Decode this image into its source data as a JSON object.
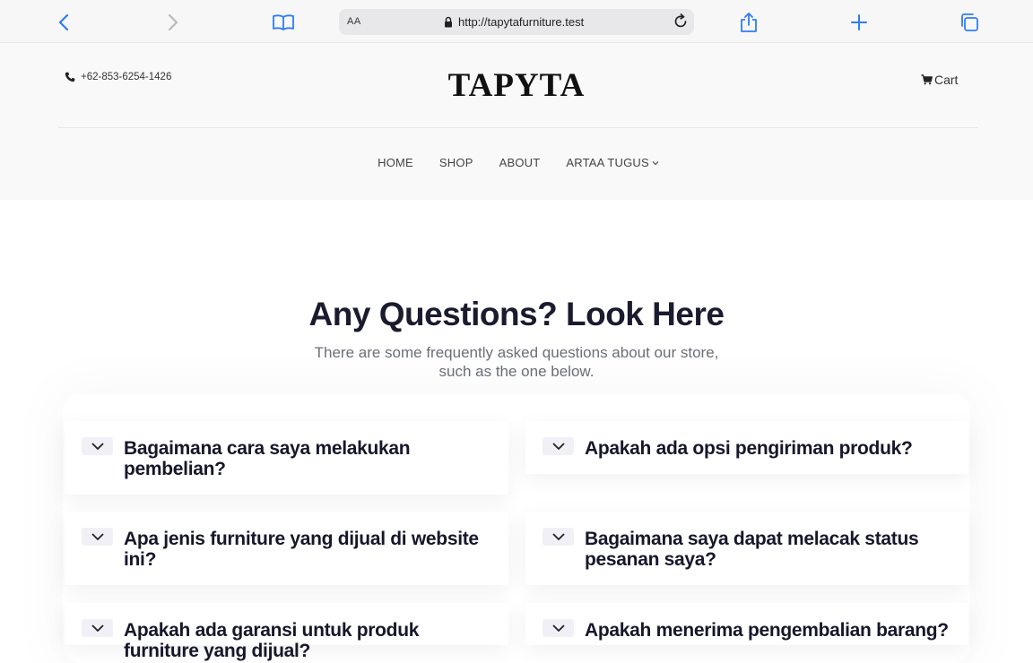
{
  "browser": {
    "url": "http://tapytafurniture.test",
    "reader_label": "AA",
    "icons": [
      "back-icon",
      "forward-icon",
      "bookmarks-icon",
      "lock-icon",
      "reload-icon",
      "share-icon",
      "new-tab-icon",
      "tabs-icon"
    ]
  },
  "header": {
    "phone": "+62-853-6254-1426",
    "logo": "TAPYTA",
    "cart_label": "Cart"
  },
  "nav": {
    "items": [
      "HOME",
      "SHOP",
      "ABOUT",
      "ARTAA TUGUS"
    ]
  },
  "faq": {
    "title": "Any Questions? Look Here",
    "subtitle": "There are some frequently asked questions about our store, such as the one below.",
    "questions": [
      "Bagaimana cara saya melakukan pembelian?",
      "Apakah ada opsi pengiriman produk?",
      "Apa jenis furniture yang dijual di website ini?",
      "Bagaimana saya dapat melacak status pesanan saya?",
      "Apakah ada garansi untuk produk furniture yang dijual?",
      "Apakah menerima pengembalian barang?"
    ]
  },
  "colors": {
    "accent_blue": "#2f7cf6",
    "heading": "#1a1b2e",
    "subtext": "#6b6f78",
    "header_bg": "#f9f9f9"
  }
}
